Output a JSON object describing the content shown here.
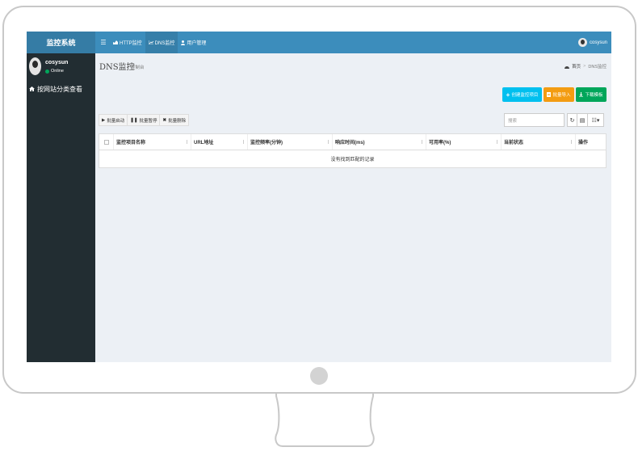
{
  "brand": "监控系统",
  "topnav": [
    {
      "label": "HTTP监控",
      "icon": "chart-area-icon",
      "active": false
    },
    {
      "label": "DNS监控",
      "icon": "chart-line-icon",
      "active": true
    },
    {
      "label": "用户管理",
      "icon": "user-icon",
      "active": false
    }
  ],
  "user": {
    "name": "cosysun",
    "status": "Online"
  },
  "sidebar": {
    "menu_label": "按网站分类查看"
  },
  "page": {
    "title": "DNS监控",
    "subtitle": "控制台",
    "breadcrumb": {
      "home": "首页",
      "current": "DNS监控"
    }
  },
  "actions": {
    "create": "创建监控项目",
    "import": "批量导入",
    "download": "下载模板"
  },
  "bulk": {
    "start": "批量启动",
    "pause": "批量暂停",
    "delete": "批量删除"
  },
  "search": {
    "placeholder": "搜索"
  },
  "table": {
    "columns": [
      "监控项目名称",
      "URL地址",
      "监控频率(分钟)",
      "响应时间(ms)",
      "可用率(%)",
      "当前状态",
      "操作"
    ],
    "empty": "没有找到匹配的记录"
  },
  "colors": {
    "header": "#3c8dbc",
    "sidebar": "#222d32",
    "info": "#00c0ef",
    "warning": "#f39c12",
    "success": "#00a65a"
  }
}
